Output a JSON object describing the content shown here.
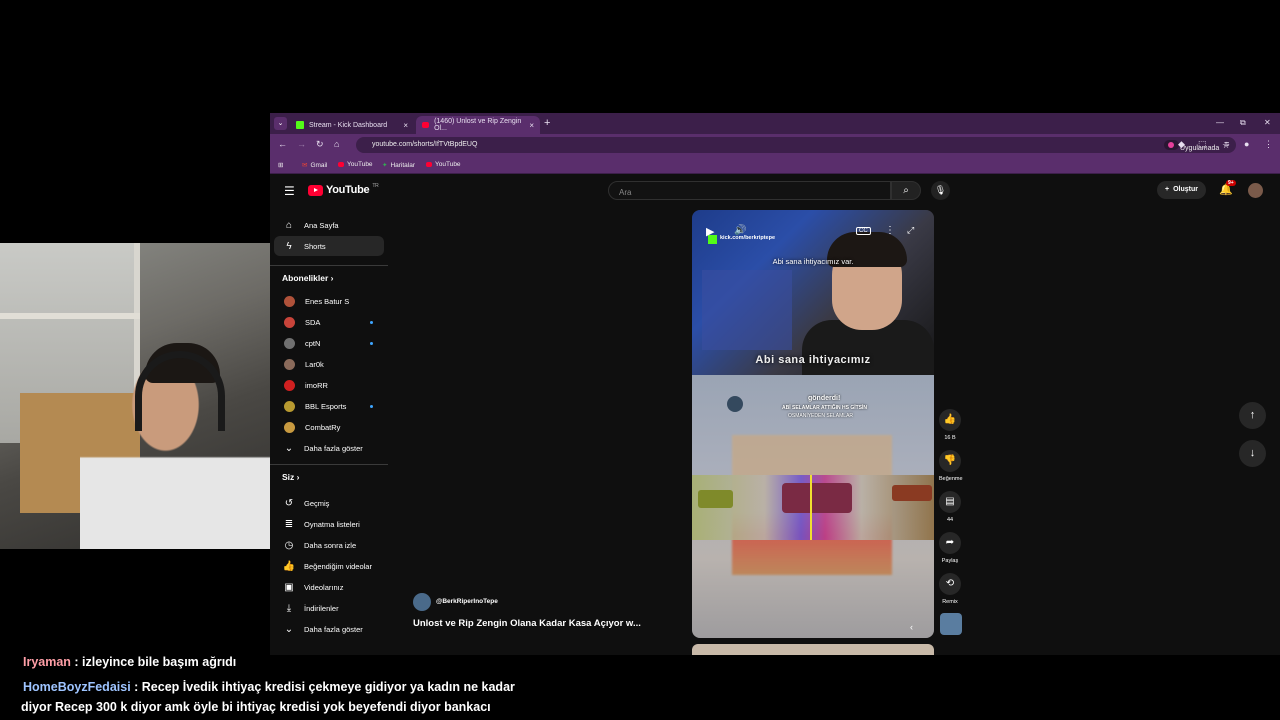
{
  "browser": {
    "tabs": [
      {
        "label": "Stream - Kick Dashboard"
      },
      {
        "label": "(1460) Unlost ve Rip Zengin Ol..."
      }
    ],
    "url": "youtube.com/shorts/IfTVtBpdEUQ",
    "open_in_app": "Uygulamada aç",
    "bookmarks": [
      "Gmail",
      "YouTube",
      "Haritalar",
      "YouTube"
    ]
  },
  "youtube": {
    "logo": "YouTube",
    "logo_country": "TR",
    "search_placeholder": "Ara",
    "create_label": "Oluştur",
    "notif_count": "9+",
    "sidebar": {
      "main": [
        "Ana Sayfa",
        "Shorts"
      ],
      "subscriptions_header": "Abonelikler",
      "channels": [
        "Enes Batur S",
        "SDA",
        "cptN",
        "Lar0k",
        "imoRR",
        "BBL Esports",
        "CombatRy"
      ],
      "show_more": "Daha fazla göster",
      "you_header": "Siz",
      "you_items": [
        "Geçmiş",
        "Oynatma listeleri",
        "Daha sonra izle",
        "Beğendiğim videolar",
        "Videolarınız",
        "İndirilenler"
      ],
      "show_more_2": "Daha fazla göster"
    },
    "short": {
      "handle": "kick.com/berkriptepe",
      "caption_top": "Abi sana ihtiyacımız var.",
      "caption_bottom": "Abi sana ihtiyacımız",
      "donation_title": "gönderdi!",
      "donation_line1": "ABİ SELAMLAR ATTIĞIN HS GİTSİN",
      "donation_line2": "OSMANİYEDEN SELAMLAR",
      "channel": "@BerkRiperInoTepe",
      "title": "Unlost ve Rip Zengin Olana Kadar Kasa Açıyor w...",
      "likes": "16 B",
      "dislike_label": "Beğenme",
      "comments": "44",
      "share_label": "Paylaş",
      "remix_label": "Remix"
    }
  },
  "chat": [
    {
      "user": "Iryaman",
      "text": " : izleyince bile başım ağrıdı"
    },
    {
      "user": "HomeBoyzFedaisi",
      "text": " : Recep İvedik ihtiyaç kredisi çekmeye gidiyor ya kadın ne kadar"
    },
    {
      "user": "",
      "text": "diyor Recep 300 k diyor amk öyle bi ihtiyaç kredisi yok beyefendi diyor bankacı"
    }
  ],
  "colors": {
    "tab_bar": "#3c1f4a",
    "toolbar": "#5a2e6c",
    "yt_red": "#ff0033",
    "kick_green": "#53fc18",
    "chat_user1": "#ff9fa7",
    "chat_user2": "#9ec4ff"
  }
}
